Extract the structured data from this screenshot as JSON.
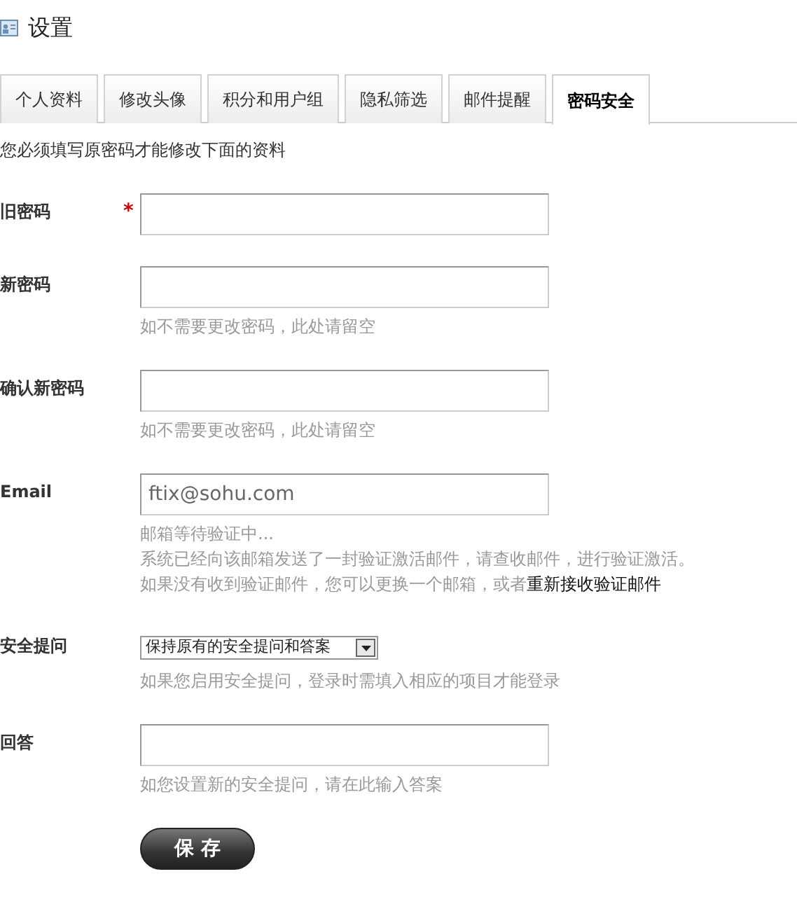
{
  "page": {
    "title": "设置"
  },
  "tabs": [
    {
      "label": "个人资料",
      "selected": false
    },
    {
      "label": "修改头像",
      "selected": false
    },
    {
      "label": "积分和用户组",
      "selected": false
    },
    {
      "label": "隐私筛选",
      "selected": false
    },
    {
      "label": "邮件提醒",
      "selected": false
    },
    {
      "label": "密码安全",
      "selected": true
    }
  ],
  "notice": "您必须填写原密码才能修改下面的资料",
  "fields": [
    {
      "kind": "text",
      "label": "旧密码",
      "required_mark": "*"
    },
    {
      "kind": "text",
      "label": "新密码",
      "hints": [
        {
          "text": "如不需要更改密码，此处请留空"
        }
      ]
    },
    {
      "kind": "text",
      "label": "确认新密码",
      "hints": [
        {
          "text": "如不需要更改密码，此处请留空"
        }
      ]
    },
    {
      "kind": "text",
      "label": "Email",
      "value": "ftix@sohu.com",
      "hints": [
        {
          "text": "邮箱等待验证中..."
        },
        {
          "text": "系统已经向该邮箱发送了一封验证激活邮件，请查收邮件，进行验证激活。"
        },
        {
          "text": "如果没有收到验证邮件，您可以更换一个邮箱，或者",
          "link": "重新接收验证邮件"
        }
      ]
    },
    {
      "kind": "select",
      "label": "安全提问",
      "value": "保持原有的安全提问和答案",
      "hints": [
        {
          "text": "如果您启用安全提问，登录时需填入相应的项目才能登录"
        }
      ]
    },
    {
      "kind": "text",
      "label": "回答",
      "hints": [
        {
          "text": "如您设置新的安全提问，请在此输入答案"
        }
      ]
    }
  ],
  "save_button": "保 存"
}
